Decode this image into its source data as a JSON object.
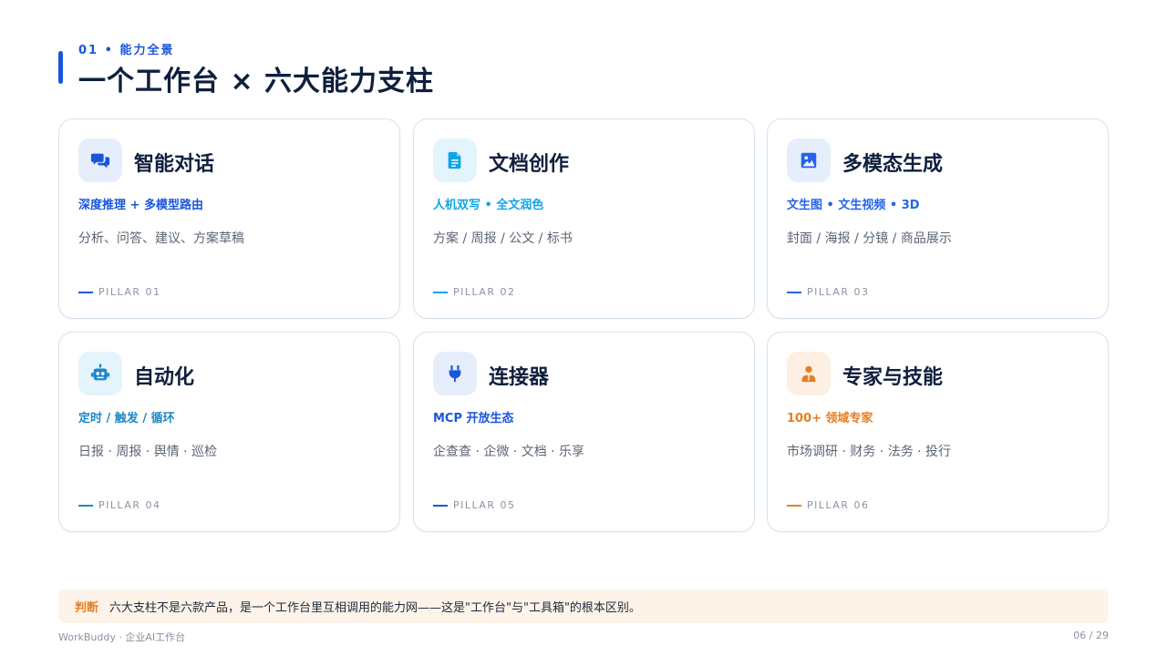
{
  "header": {
    "eyebrow": "01 • 能力全景",
    "title": "一个工作台 × 六大能力支柱"
  },
  "cards": [
    {
      "icon": "chat-bubbles-icon",
      "title": "智能对话",
      "tag": "深度推理 + 多模型路由",
      "desc": "分析、问答、建议、方案草稿",
      "pillar": "PILLAR 01",
      "accent": "#1a56db",
      "tag_color": "#1a56db",
      "icon_bg": "#e6eefc"
    },
    {
      "icon": "document-icon",
      "title": "文档创作",
      "tag": "人机双写 • 全文润色",
      "desc": "方案 / 周报 / 公文 / 标书",
      "pillar": "PILLAR 02",
      "accent": "#0ea5e9",
      "tag_color": "#0ea5e9",
      "icon_bg": "#e4f4fc"
    },
    {
      "icon": "image-icon",
      "title": "多模态生成",
      "tag": "文生图 • 文生视频 • 3D",
      "desc": "封面 / 海报 / 分镜 / 商品展示",
      "pillar": "PILLAR 03",
      "accent": "#2563eb",
      "tag_color": "#2563eb",
      "icon_bg": "#e6eefc"
    },
    {
      "icon": "robot-icon",
      "title": "自动化",
      "tag": "定时 / 触发 / 循环",
      "desc": "日报 · 周报 · 舆情 · 巡检",
      "pillar": "PILLAR 04",
      "accent": "#1e88c8",
      "tag_color": "#1e88c8",
      "icon_bg": "#e4f4fc"
    },
    {
      "icon": "plug-icon",
      "title": "连接器",
      "tag": "MCP 开放生态",
      "desc": "企查查 · 企微 · 文档 · 乐享",
      "pillar": "PILLAR 05",
      "accent": "#1a56db",
      "tag_color": "#1a56db",
      "icon_bg": "#e6eefc"
    },
    {
      "icon": "expert-icon",
      "title": "专家与技能",
      "tag": "100+ 领域专家",
      "desc": "市场调研 · 财务 · 法务 · 投行",
      "pillar": "PILLAR 06",
      "accent": "#e67e22",
      "tag_color": "#e67e22",
      "icon_bg": "#fdf0e2"
    }
  ],
  "note": {
    "label": "判断",
    "text": "六大支柱不是六款产品，是一个工作台里互相调用的能力网——这是\"工作台\"与\"工具箱\"的根本区别。"
  },
  "footer": {
    "left": "WorkBuddy · 企业AI工作台",
    "right": "06 / 29"
  }
}
